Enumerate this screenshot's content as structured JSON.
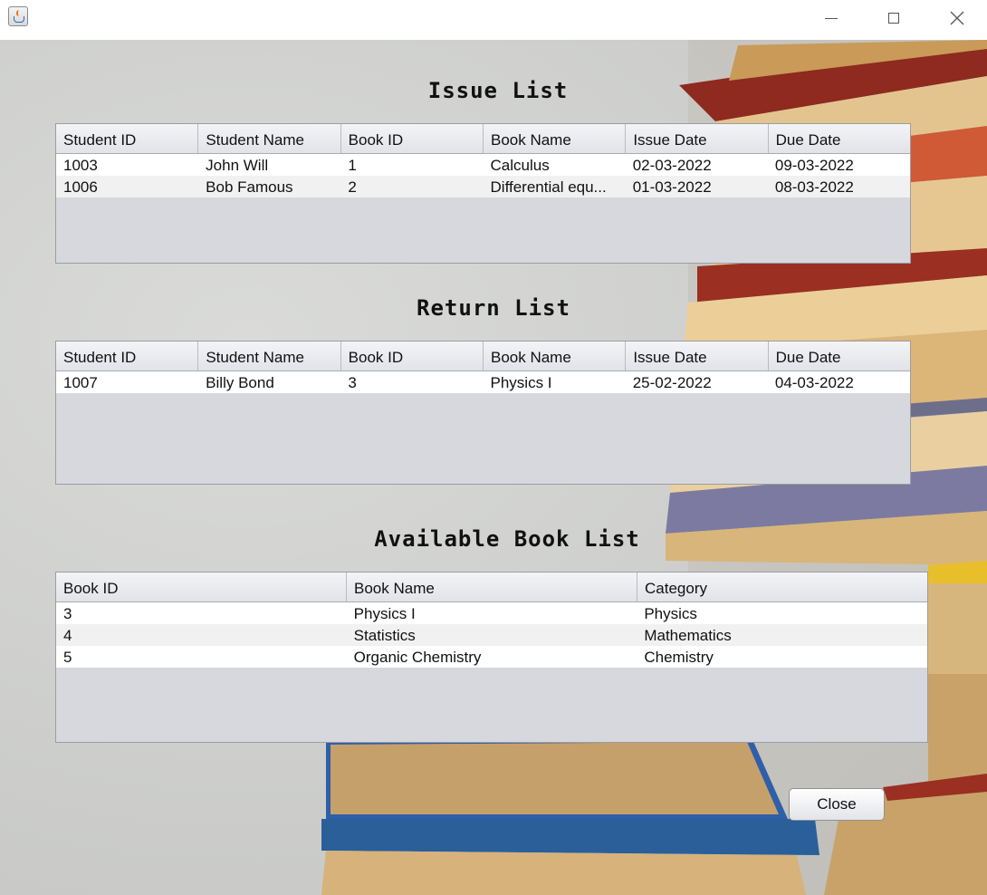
{
  "window": {
    "title": ""
  },
  "issue_list": {
    "title": "Issue List",
    "columns": [
      "Student ID",
      "Student Name",
      "Book ID",
      "Book Name",
      "Issue Date",
      "Due Date"
    ],
    "rows": [
      [
        "1003",
        "John Will",
        "1",
        "Calculus",
        "02-03-2022",
        "09-03-2022"
      ],
      [
        "1006",
        "Bob Famous",
        "2",
        "Differential equ...",
        "01-03-2022",
        "08-03-2022"
      ]
    ]
  },
  "return_list": {
    "title": "Return List",
    "columns": [
      "Student ID",
      "Student Name",
      "Book ID",
      "Book Name",
      "Issue Date",
      "Due Date"
    ],
    "rows": [
      [
        "1007",
        "Billy Bond",
        "3",
        "Physics I",
        "25-02-2022",
        "04-03-2022"
      ]
    ]
  },
  "available_list": {
    "title": "Available Book List",
    "columns": [
      "Book ID",
      "Book Name",
      "Category"
    ],
    "rows": [
      [
        "3",
        "Physics I",
        "Physics"
      ],
      [
        "4",
        "Statistics",
        "Mathematics"
      ],
      [
        "5",
        "Organic Chemistry",
        "Chemistry"
      ]
    ]
  },
  "close_button": {
    "label": "Close"
  },
  "icons": {
    "app": "java-cup-icon",
    "minimize": "minimize-icon",
    "maximize": "maximize-icon",
    "close": "close-icon"
  }
}
